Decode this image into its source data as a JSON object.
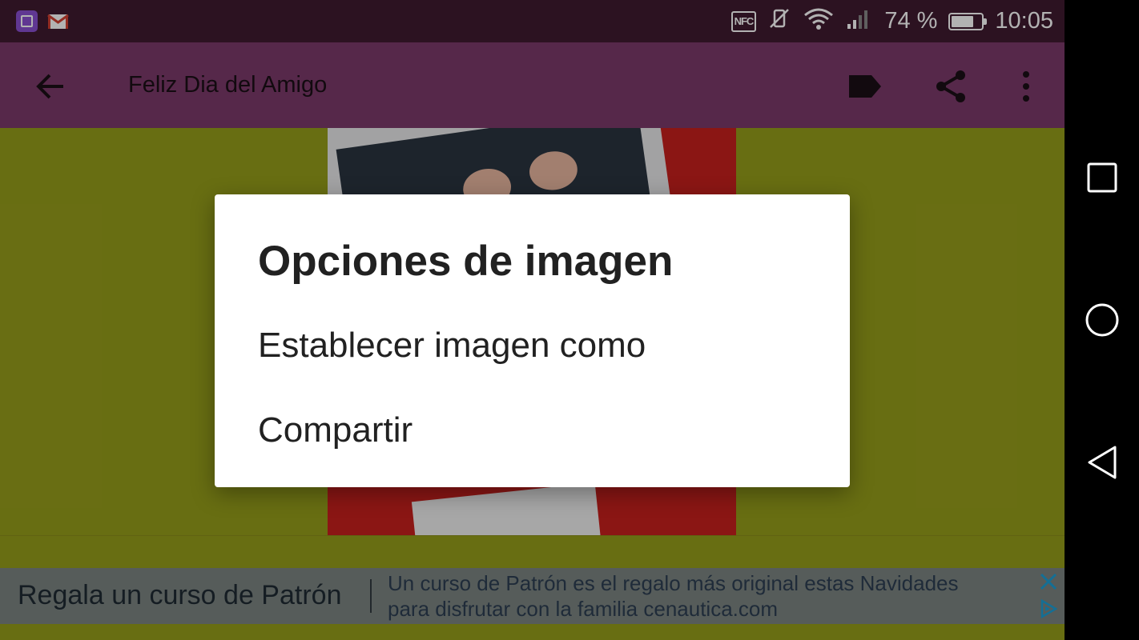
{
  "status_bar": {
    "left_icons": [
      "gallery-app-icon",
      "gmail-icon"
    ],
    "nfc_label": "NFC",
    "battery_percent": "74 %",
    "battery_level": 74,
    "time": "10:05"
  },
  "toolbar": {
    "title": "Feliz Dia del Amigo",
    "icons": [
      "back-arrow-icon",
      "tag-icon",
      "share-icon",
      "more-vert-icon"
    ]
  },
  "dialog": {
    "title": "Opciones de imagen",
    "items": [
      {
        "label": "Establecer imagen como"
      },
      {
        "label": "Compartir"
      }
    ]
  },
  "ad": {
    "headline": "Regala un curso de Patrón",
    "body_line1": "Un curso de Patrón es el regalo más original estas Navidades",
    "body_line2": "para disfrutar con la familia cenautica.com",
    "icons": [
      "close-icon",
      "adchoices-icon"
    ]
  },
  "nav_bar": {
    "buttons": [
      "recents-icon",
      "home-icon",
      "back-icon"
    ]
  },
  "colors": {
    "status_bar": "#3f1a30",
    "toolbar": "#7b3a6a",
    "background": "#969e1b",
    "image_bg": "#c8201d"
  }
}
